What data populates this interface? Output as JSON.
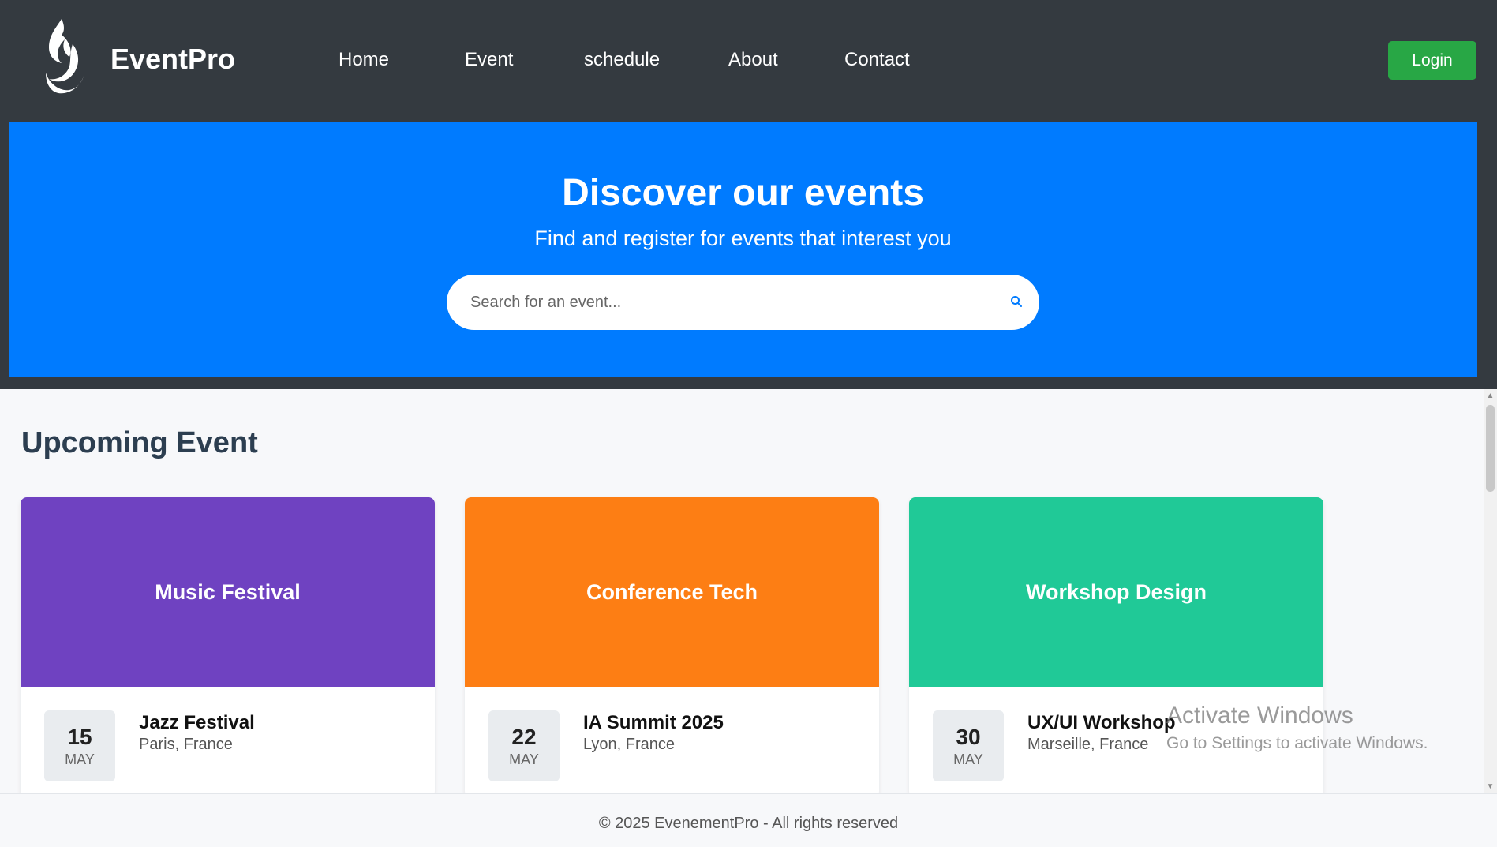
{
  "header": {
    "brand": "EventPro",
    "nav": [
      "Home",
      "Event",
      "schedule",
      "About",
      "Contact"
    ],
    "login_label": "Login"
  },
  "hero": {
    "title": "Discover our events",
    "subtitle": "Find and register for events that interest you",
    "search_placeholder": "Search for an event..."
  },
  "section": {
    "title": "Upcoming Event"
  },
  "events": [
    {
      "banner": "Music Festival",
      "color": "#6f42c1",
      "day": "15",
      "month": "MAY",
      "name": "Jazz Festival",
      "location": "Paris, France"
    },
    {
      "banner": "Conference Tech",
      "color": "#fd7e14",
      "day": "22",
      "month": "MAY",
      "name": "IA Summit 2025",
      "location": "Lyon, France"
    },
    {
      "banner": "Workshop Design",
      "color": "#20c997",
      "day": "30",
      "month": "MAY",
      "name": "UX/UI Workshop",
      "location": "Marseille, France"
    }
  ],
  "watermark": {
    "title": "Activate Windows",
    "subtitle": "Go to Settings to activate Windows."
  },
  "footer": {
    "text": "© 2025 EvenementPro - All rights reserved"
  },
  "colors": {
    "header_bg": "#343a40",
    "hero_bg": "#007bff",
    "login_bg": "#28a745"
  }
}
